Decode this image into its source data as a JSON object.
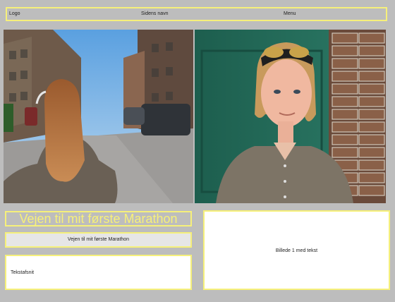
{
  "header": {
    "logo": "Logo",
    "site_name": "Sidens navn",
    "menu": "Menu"
  },
  "main": {
    "heading": "Vejen til mit første Marathon",
    "subheading": "Vejen til mit første Marathon",
    "text_section": "Tekstafsnit",
    "image_text": "Billede 1 med tekst"
  },
  "colors": {
    "background": "#bdbdbd",
    "accent_yellow": "#f6f07a",
    "box_white": "#ffffff",
    "subheading_fill": "#e6e6e6"
  }
}
